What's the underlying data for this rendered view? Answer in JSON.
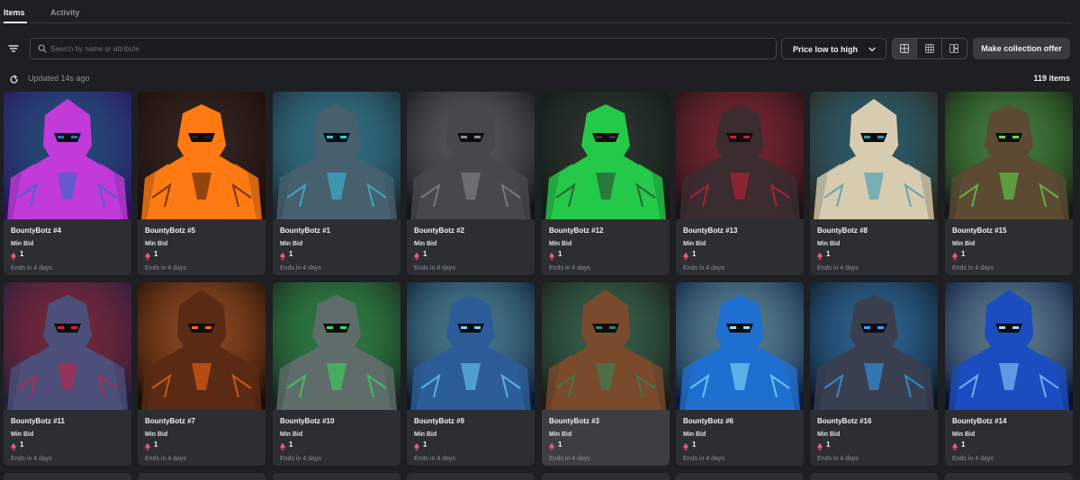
{
  "tabs": [
    {
      "label": "Items",
      "active": true
    },
    {
      "label": "Activity",
      "active": false
    }
  ],
  "search": {
    "placeholder": "Search by name or attribute",
    "value": ""
  },
  "sort": {
    "label": "Price low to high"
  },
  "view_modes": [
    "grid-large-icon",
    "grid-small-icon",
    "gallery-icon"
  ],
  "offer_button": {
    "label": "Make collection offer"
  },
  "status": {
    "updated": "Updated 14s ago",
    "count": "119 items"
  },
  "card_labels": {
    "min_bid": "Min Bid",
    "currency_icon": "eth-icon"
  },
  "items": [
    {
      "name": "BountyBotz #4",
      "price": "1",
      "ends": "Ends in 4 days",
      "palette": [
        "#2a1358",
        "#c23ad9",
        "#1c73c9"
      ]
    },
    {
      "name": "BountyBotz #5",
      "price": "1",
      "ends": "Ends in 4 days",
      "palette": [
        "#1a0f0a",
        "#ff7a12",
        "#3a1a10"
      ]
    },
    {
      "name": "BountyBotz #1",
      "price": "1",
      "ends": "Ends in 4 days",
      "palette": [
        "#1b2630",
        "#46606e",
        "#39c3e6"
      ]
    },
    {
      "name": "BountyBotz #2",
      "price": "1",
      "ends": "Ends in 4 days",
      "palette": [
        "#141416",
        "#47474d",
        "#8a8a92"
      ]
    },
    {
      "name": "BountyBotz #12",
      "price": "1",
      "ends": "Ends in 4 days",
      "palette": [
        "#0f1a12",
        "#24c94a",
        "#2e3a30"
      ]
    },
    {
      "name": "BountyBotz #13",
      "price": "1",
      "ends": "Ends in 4 days",
      "palette": [
        "#1a1216",
        "#3b2c30",
        "#d11f33"
      ]
    },
    {
      "name": "BountyBotz #8",
      "price": "1",
      "ends": "Ends in 4 days",
      "palette": [
        "#2a2418",
        "#d8ccb0",
        "#2c96b8"
      ]
    },
    {
      "name": "BountyBotz #15",
      "price": "1",
      "ends": "Ends in 4 days",
      "palette": [
        "#141a12",
        "#5c4a32",
        "#5ee04a"
      ]
    },
    {
      "name": "BountyBotz #11",
      "price": "1",
      "ends": "Ends in 4 days",
      "palette": [
        "#221f3a",
        "#4b4f7a",
        "#d11f44"
      ]
    },
    {
      "name": "BountyBotz #7",
      "price": "1",
      "ends": "Ends in 4 days",
      "palette": [
        "#180d08",
        "#5a2a14",
        "#ff6a12"
      ]
    },
    {
      "name": "BountyBotz #10",
      "price": "1",
      "ends": "Ends in 4 days",
      "palette": [
        "#1a2320",
        "#5f6d6a",
        "#33e05a"
      ]
    },
    {
      "name": "BountyBotz #9",
      "price": "1",
      "ends": "Ends in 4 days",
      "palette": [
        "#0c1a2e",
        "#2d5c9a",
        "#6ad6ff"
      ]
    },
    {
      "name": "BountyBotz #3",
      "price": "1",
      "ends": "Ends in 4 days",
      "palette": [
        "#1c1a14",
        "#7a4a2c",
        "#2e8a5a"
      ],
      "hovered": true
    },
    {
      "name": "BountyBotz #6",
      "price": "1",
      "ends": "Ends in 4 days",
      "palette": [
        "#0a1a3a",
        "#1f6fd0",
        "#8fe4ff"
      ]
    },
    {
      "name": "BountyBotz #16",
      "price": "1",
      "ends": "Ends in 4 days",
      "palette": [
        "#101420",
        "#3a3f50",
        "#2fa6ff"
      ]
    },
    {
      "name": "BountyBotz #14",
      "price": "1",
      "ends": "Ends in 4 days",
      "palette": [
        "#061232",
        "#1b4cc0",
        "#9ad8ff"
      ]
    }
  ]
}
